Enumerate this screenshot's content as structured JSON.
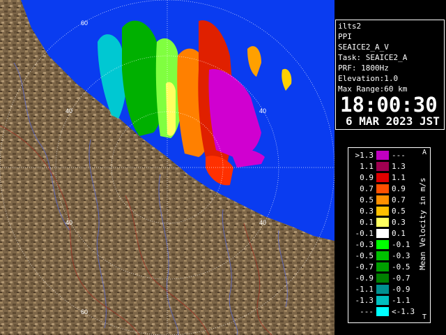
{
  "info": {
    "site": "ilts2",
    "product": "PPI",
    "scan": "SEAICE2_A_V",
    "task": "Task: SEAICE2_A",
    "prf": "PRF: 1800Hz",
    "elevation": "Elevation:1.0",
    "max_range": "Max Range:60 km",
    "time": "18:00:30",
    "date": "6 MAR 2023 JST"
  },
  "legend": {
    "units": "Mean Velocity in m/s",
    "top_marker": "A",
    "bottom_marker": "T",
    "rows": [
      {
        "lo": ">1.3",
        "hi": "---",
        "color": "#c000c0"
      },
      {
        "lo": "1.1",
        "hi": "1.3",
        "color": "#a00050"
      },
      {
        "lo": "0.9",
        "hi": "1.1",
        "color": "#e00000"
      },
      {
        "lo": "0.7",
        "hi": "0.9",
        "color": "#ff5000"
      },
      {
        "lo": "0.5",
        "hi": "0.7",
        "color": "#ff9000"
      },
      {
        "lo": "0.3",
        "hi": "0.5",
        "color": "#ffc000"
      },
      {
        "lo": "0.1",
        "hi": "0.3",
        "color": "#ffff60"
      },
      {
        "lo": "-0.1",
        "hi": "0.1",
        "color": "#ffffff"
      },
      {
        "lo": "-0.3",
        "hi": "-0.1",
        "color": "#00ff00"
      },
      {
        "lo": "-0.5",
        "hi": "-0.3",
        "color": "#00c000"
      },
      {
        "lo": "-0.7",
        "hi": "-0.5",
        "color": "#00a000"
      },
      {
        "lo": "-0.9",
        "hi": "-0.7",
        "color": "#008000"
      },
      {
        "lo": "-1.1",
        "hi": "-0.9",
        "color": "#009090"
      },
      {
        "lo": "-1.3",
        "hi": "-1.1",
        "color": "#00c0c0"
      },
      {
        "lo": "---",
        "hi": "<-1.3",
        "color": "#00ffff"
      }
    ]
  },
  "range_ring_labels": [
    "60",
    "40",
    "40",
    "40",
    "40",
    "60"
  ],
  "colors": {
    "sea": "#0a3cf0",
    "land": "#7a6446",
    "ring": "#ffffff"
  }
}
